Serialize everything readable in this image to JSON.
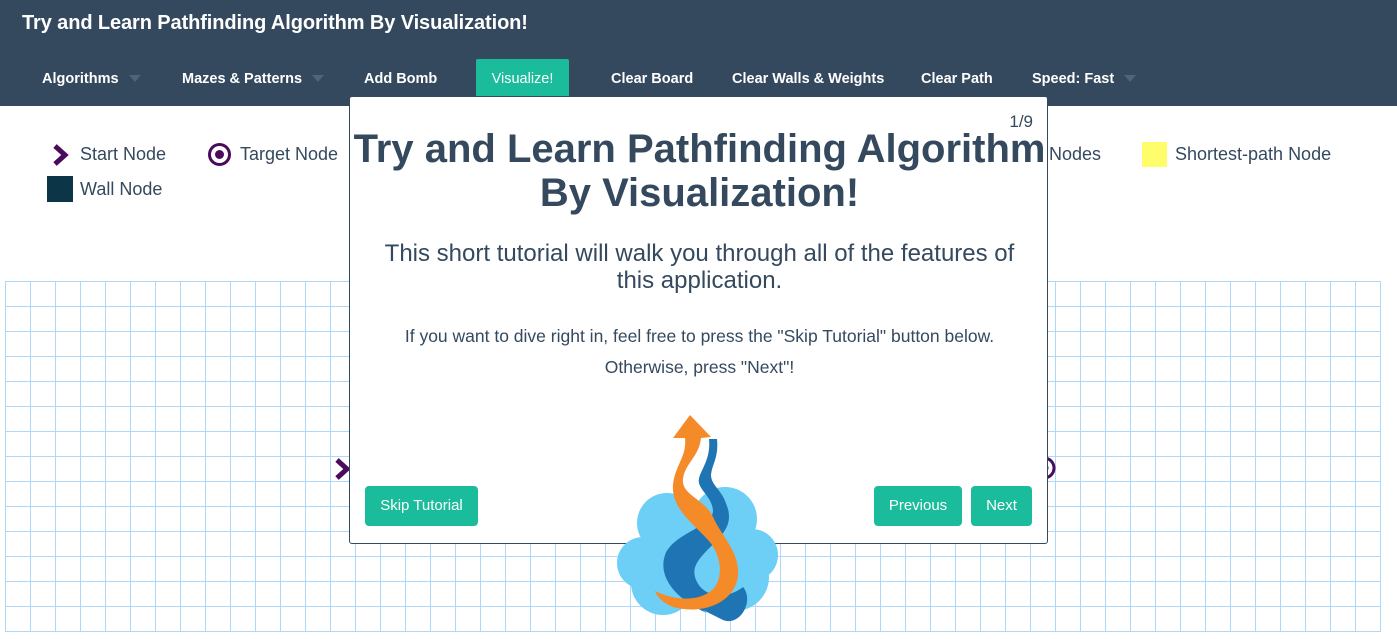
{
  "navbar": {
    "brand": "Try and Learn Pathfinding Algorithm By Visualization!",
    "algorithms": "Algorithms",
    "mazes": "Mazes & Patterns",
    "add_bomb": "Add Bomb",
    "visualize": "Visualize!",
    "clear_board": "Clear Board",
    "clear_walls": "Clear Walls & Weights",
    "clear_path": "Clear Path",
    "speed": "Speed: Fast",
    "background_color": "#34495e",
    "accent_color": "#1abc9c"
  },
  "legend": {
    "start_node": "Start Node",
    "target_node": "Target Node",
    "nodes_partial": "Nodes",
    "shortest_path_node": "Shortest-path Node",
    "wall_node": "Wall Node"
  },
  "modal": {
    "counter": "1/9",
    "title_line1": "Try and Learn Pathfinding Algorithm",
    "title_line2": "By Visualization!",
    "subtitle": "This short tutorial will walk you through all of the features of this application.",
    "body_line1": "If you want to dive right in, feel free to press the \"Skip Tutorial\" button below.",
    "body_line2": "Otherwise, press \"Next\"!",
    "skip_label": "Skip Tutorial",
    "previous_label": "Previous",
    "next_label": "Next"
  },
  "colors": {
    "text": "#34495e",
    "grid_line": "#afd8f8",
    "wall": "#0c3547",
    "shortest_path": "#fffe6a",
    "start_target": "#4b0b5c"
  }
}
